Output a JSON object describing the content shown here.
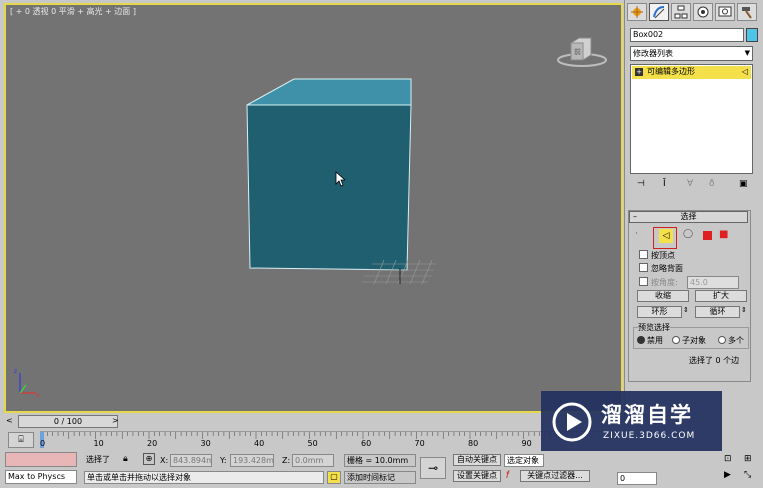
{
  "viewport": {
    "label": "[ + 0 透视 0 平滑 + 高光 + 边面 ]"
  },
  "command_panel": {
    "object_name": "Box002",
    "modifier_list": "修改器列表",
    "stack_item": "可编辑多边形",
    "rollout_title": "选择",
    "by_vertex": "按顶点",
    "ignore_backfacing": "忽略背面",
    "by_angle": "按角度:",
    "angle_value": "45.0",
    "shrink": "收缩",
    "grow": "扩大",
    "ring": "环形",
    "loop": "循环",
    "preview_title": "预览选择",
    "preview_off": "禁用",
    "preview_subobj": "子对象",
    "preview_multi": "多个",
    "selected_count": "选择了 0 个边"
  },
  "timeline": {
    "frame_label": "0 / 100",
    "ticks": [
      "0",
      "10",
      "20",
      "30",
      "40",
      "50",
      "60",
      "70",
      "80",
      "90"
    ]
  },
  "status": {
    "max_physics": "Max to Physcs",
    "selected": "选择了",
    "x_label": "X:",
    "x_value": "843.894mm",
    "y_label": "Y:",
    "y_value": "193.428mm",
    "z_label": "Z:",
    "z_value": "0.0mm",
    "grid": "栅格 = 10.0mm",
    "auto_key": "自动关键点",
    "selected_object": "选定对象",
    "set_key": "设置关键点",
    "key_filters": "关键点过滤器...",
    "prompt": "单击或单击并拖动以选择对象",
    "add_time_tag": "添加时间标记",
    "frame_value": "0"
  },
  "watermark": {
    "title": "溜溜自学",
    "url": "ZIXUE.3D66.COM"
  },
  "colors": {
    "viewport_bg": "#737373",
    "active_border": "#e6d84a",
    "cube_front": "#1f5f6f",
    "cube_top": "#3e91a8",
    "highlight": "#f4e04a",
    "watermark_bg": "#223060"
  }
}
